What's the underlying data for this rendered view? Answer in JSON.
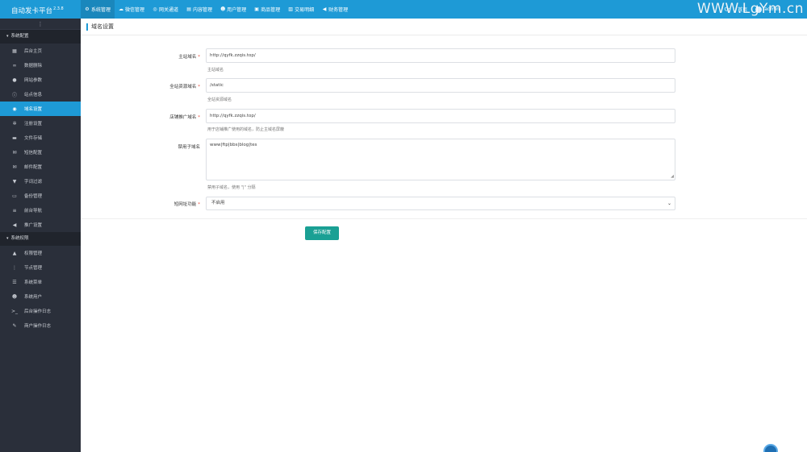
{
  "brand": {
    "title": "自动发卡平台",
    "version": "2.3.8"
  },
  "topnav": [
    {
      "label": "系统管理",
      "icon": "gear-icon",
      "glyph": "⚙",
      "active": true
    },
    {
      "label": "微信管理",
      "icon": "wechat-icon",
      "glyph": "☁"
    },
    {
      "label": "网关通道",
      "icon": "globe-icon",
      "glyph": "◎"
    },
    {
      "label": "内容管理",
      "icon": "file-icon",
      "glyph": "▤"
    },
    {
      "label": "用户管理",
      "icon": "users-icon",
      "glyph": "☻"
    },
    {
      "label": "商品管理",
      "icon": "bag-icon",
      "glyph": "▣"
    },
    {
      "label": "交易明细",
      "icon": "chart-icon",
      "glyph": "▥"
    },
    {
      "label": "财务管理",
      "icon": "megaphone-icon",
      "glyph": "◀"
    }
  ],
  "topright": {
    "refresh": "⟳",
    "home": "首页",
    "user": "admin"
  },
  "watermark": "WWW.LgYm.cn",
  "sidebar": {
    "toggle": "⋮",
    "groups": [
      {
        "label": "系统配置",
        "items": [
          {
            "label": "后台主页",
            "icon": "chart-icon",
            "glyph": "▦"
          },
          {
            "label": "数据删除",
            "icon": "link-icon",
            "glyph": "∞"
          },
          {
            "label": "网站参数",
            "icon": "apple-icon",
            "glyph": "●"
          },
          {
            "label": "站点信息",
            "icon": "info-icon",
            "glyph": "ⓘ"
          },
          {
            "label": "域名设置",
            "icon": "globe-icon",
            "glyph": "◉",
            "active": true
          },
          {
            "label": "注册设置",
            "icon": "gear-icon",
            "glyph": "✲"
          },
          {
            "label": "文件存储",
            "icon": "truck-icon",
            "glyph": "▬"
          },
          {
            "label": "短信配置",
            "icon": "envelope-icon",
            "glyph": "✉"
          },
          {
            "label": "邮件配置",
            "icon": "envelope-icon",
            "glyph": "✉"
          },
          {
            "label": "字词过滤",
            "icon": "filter-icon",
            "glyph": "▼"
          },
          {
            "label": "备份管理",
            "icon": "cart-icon",
            "glyph": "▭"
          },
          {
            "label": "前台导航",
            "icon": "list-icon",
            "glyph": "≡"
          },
          {
            "label": "推广设置",
            "icon": "megaphone-icon",
            "glyph": "◀"
          }
        ]
      },
      {
        "label": "系统权限",
        "items": [
          {
            "label": "权限管理",
            "icon": "lock-icon",
            "glyph": "▲"
          },
          {
            "label": "节点管理",
            "icon": "dots-icon",
            "glyph": "⋮"
          },
          {
            "label": "系统菜单",
            "icon": "menu-icon",
            "glyph": "☰"
          },
          {
            "label": "系统用户",
            "icon": "users-icon",
            "glyph": "☻"
          },
          {
            "label": "后台操作日志",
            "icon": "terminal-icon",
            "glyph": ">_"
          },
          {
            "label": "商户操作日志",
            "icon": "pin-icon",
            "glyph": "✎"
          }
        ]
      }
    ]
  },
  "page": {
    "title": "域名设置"
  },
  "form": {
    "main_domain": {
      "label": "主站域名",
      "value": "http://qyfk.zzqis.top/",
      "help": "主站域名"
    },
    "static_domain": {
      "label": "全站资源域名",
      "value": "/static",
      "help": "全站资源域名"
    },
    "shop_domain": {
      "label": "店铺推广域名",
      "value": "http://qyfk.zzqis.top/",
      "help": "用于店铺推广使用的域名，防止主域名屏蔽"
    },
    "banned_sub": {
      "label": "禁用子域名",
      "value": "www|ftp|bbs|blog|tes",
      "help": "禁用子域名，使用 \"|\" 分隔"
    },
    "short_url": {
      "label": "短网址功能",
      "value": "不启用"
    },
    "save_label": "保存配置"
  },
  "colors": {
    "primary": "#1e9ad6",
    "sidebar": "#2a2f3a",
    "save": "#1aa094"
  }
}
